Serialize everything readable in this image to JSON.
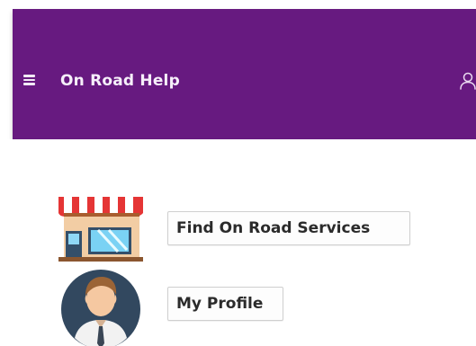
{
  "app_bar": {
    "title": "On Road Help",
    "menu_icon": "hamburger-menu-icon",
    "profile_icon": "user-icon",
    "color": "#671a80",
    "text_color": "#f6effa"
  },
  "main": {
    "items": [
      {
        "label": "Find On Road Services",
        "icon": "shop-storefront-icon"
      },
      {
        "label": "My Profile",
        "icon": "user-avatar-icon"
      }
    ]
  }
}
